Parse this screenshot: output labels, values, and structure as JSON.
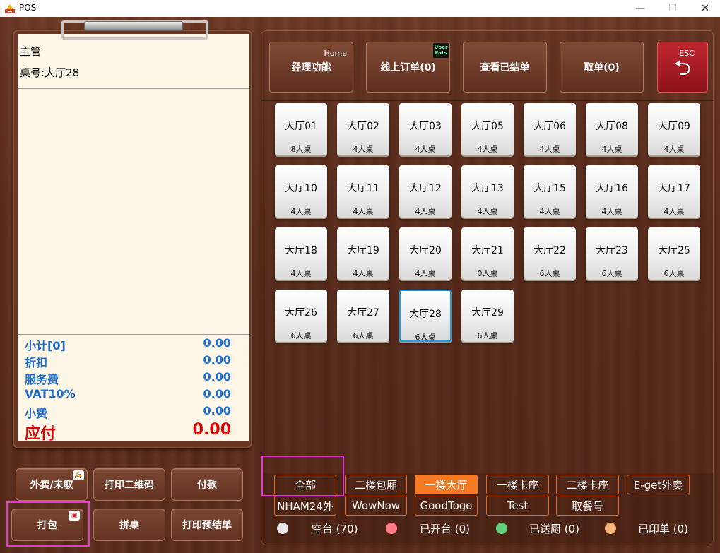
{
  "window": {
    "title": "POS",
    "min_glyph": "—",
    "max_glyph": "☐",
    "close_glyph": "✕"
  },
  "order": {
    "role": "主管",
    "table_label": "桌号:大厅28",
    "totals": [
      {
        "label": "小计[0]",
        "value": "0.00"
      },
      {
        "label": "折扣",
        "value": "0.00"
      },
      {
        "label": "服务费",
        "value": "0.00"
      },
      {
        "label": "VAT10%",
        "value": "0.00"
      },
      {
        "label": "小费",
        "value": "0.00"
      }
    ],
    "amount_due": {
      "label": "应付",
      "value": "0.00"
    }
  },
  "left_buttons": {
    "takeout": "外卖/未取",
    "print_qr": "打印二维码",
    "pay": "付款",
    "pack": "打包",
    "merge": "拼桌",
    "print_prebill": "打印预结单"
  },
  "top_buttons": {
    "manager": {
      "label": "经理功能",
      "hint": "Home"
    },
    "online_orders": {
      "label": "线上订单(0)",
      "badge_line1": "Uber",
      "badge_line2": "Eats"
    },
    "view_settled": {
      "label": "查看已结单"
    },
    "take_order": {
      "label": "取单(0)"
    },
    "esc": {
      "label": "ESC",
      "glyph": "⮌"
    }
  },
  "tables": [
    {
      "name": "大厅01",
      "capacity": "8人桌"
    },
    {
      "name": "大厅02",
      "capacity": "4人桌"
    },
    {
      "name": "大厅03",
      "capacity": "4人桌"
    },
    {
      "name": "大厅05",
      "capacity": "4人桌"
    },
    {
      "name": "大厅06",
      "capacity": "4人桌"
    },
    {
      "name": "大厅08",
      "capacity": "4人桌"
    },
    {
      "name": "大厅09",
      "capacity": "4人桌"
    },
    {
      "name": "大厅10",
      "capacity": "4人桌"
    },
    {
      "name": "大厅11",
      "capacity": "4人桌"
    },
    {
      "name": "大厅12",
      "capacity": "4人桌"
    },
    {
      "name": "大厅13",
      "capacity": "4人桌"
    },
    {
      "name": "大厅15",
      "capacity": "4人桌"
    },
    {
      "name": "大厅16",
      "capacity": "4人桌"
    },
    {
      "name": "大厅17",
      "capacity": "4人桌"
    },
    {
      "name": "大厅18",
      "capacity": "4人桌"
    },
    {
      "name": "大厅19",
      "capacity": "4人桌"
    },
    {
      "name": "大厅20",
      "capacity": "4人桌"
    },
    {
      "name": "大厅21",
      "capacity": "0人桌"
    },
    {
      "name": "大厅22",
      "capacity": "6人桌"
    },
    {
      "name": "大厅23",
      "capacity": "6人桌"
    },
    {
      "name": "大厅25",
      "capacity": "6人桌"
    },
    {
      "name": "大厅26",
      "capacity": "6人桌"
    },
    {
      "name": "大厅27",
      "capacity": "6人桌"
    },
    {
      "name": "大厅28",
      "capacity": "6人桌",
      "selected": true
    },
    {
      "name": "大厅29",
      "capacity": "6人桌"
    }
  ],
  "floors": {
    "row1": [
      "全部",
      "二楼包厢",
      "一楼大厅",
      "一楼卡座",
      "二楼卡座",
      "E-get外卖"
    ],
    "row2": [
      "NHAM24外",
      "WowNow",
      "GoodTogo",
      "Test",
      "取餐号"
    ],
    "active": "一楼大厅"
  },
  "legend": [
    {
      "label": "空台 (70)",
      "color": "#e8e8e8"
    },
    {
      "label": "已开台 (0)",
      "color": "#ff7b86"
    },
    {
      "label": "已送厨 (0)",
      "color": "#5fcf78"
    },
    {
      "label": "已印单 (0)",
      "color": "#f7b37a"
    }
  ],
  "colors": {
    "accent_orange": "#f47a24",
    "totals_blue": "#1e6fd0",
    "due_red": "#e00000",
    "esc_red": "#a81c24",
    "highlight_pink": "#e23ad5",
    "selected_blue": "#1e9be6"
  }
}
